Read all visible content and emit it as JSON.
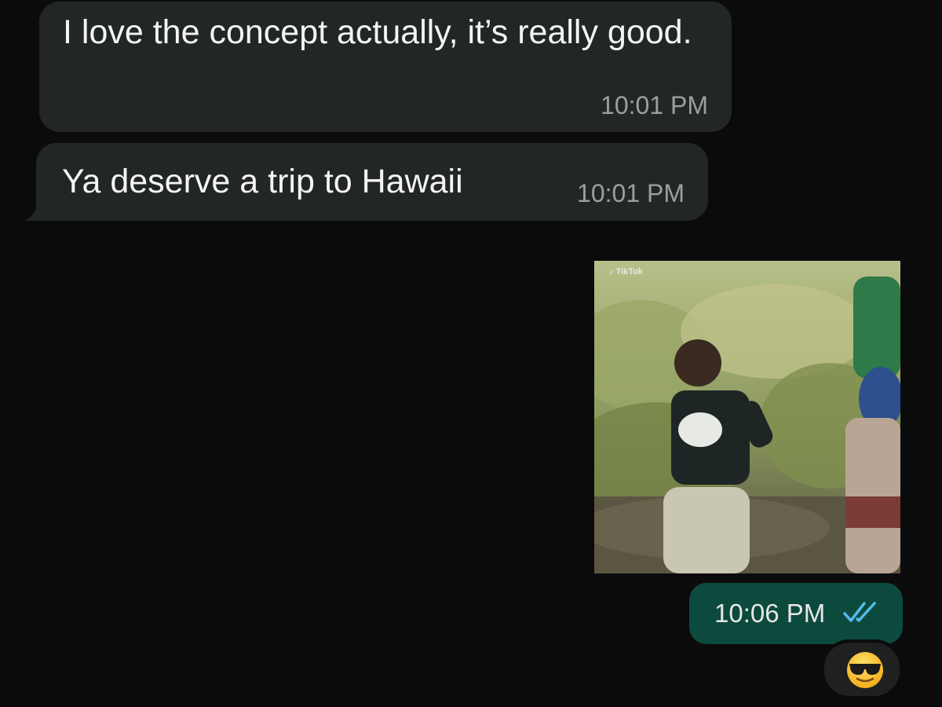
{
  "messages": [
    {
      "text": "I love the concept actually, it’s really good.",
      "time": "10:01 PM",
      "direction": "incoming"
    },
    {
      "text": "Ya deserve a trip to Hawaii",
      "time": "10:01 PM",
      "direction": "incoming"
    },
    {
      "media": {
        "type": "video",
        "watermark": "TikTok",
        "icon": "tiktok-icon"
      },
      "direction": "outgoing"
    },
    {
      "time": "10:06 PM",
      "status": "read",
      "status_icon": "double-check-icon",
      "direction": "outgoing"
    }
  ],
  "reaction": {
    "emoji": "😎",
    "icon": "sunglasses-face-icon"
  },
  "colors": {
    "background": "#0b0b0c",
    "incoming_bubble": "#232626",
    "outgoing_bubble": "#0d4a3e",
    "read_ticks": "#53bdeb"
  }
}
